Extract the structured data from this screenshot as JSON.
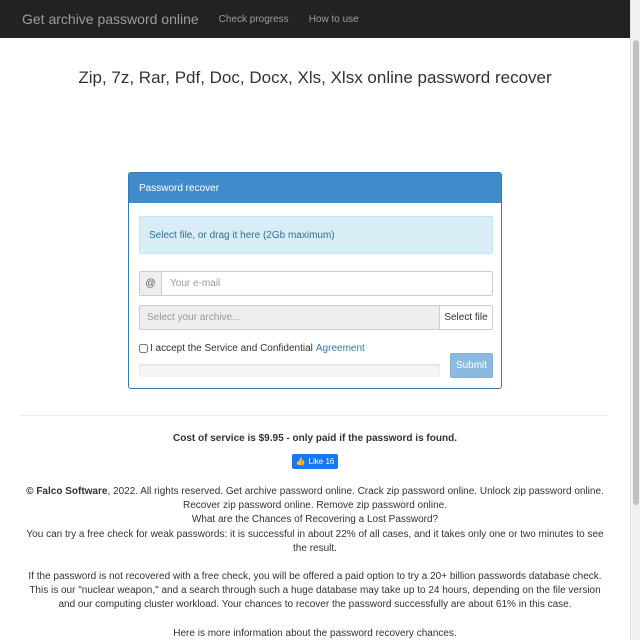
{
  "navbar": {
    "brand": "Get archive password online",
    "links": [
      "Check progress",
      "How to use"
    ]
  },
  "page_title": "Zip, 7z, Rar, Pdf, Doc, Docx, Xls, Xlsx online password recover",
  "panel": {
    "heading": "Password recover",
    "drop_zone_text": "Select file, or drag it here (2Gb maximum)",
    "email_addon": "@",
    "email_placeholder": "Your e-mail",
    "archive_placeholder": "Select your archive...",
    "select_file_label": "Select file",
    "agree_text": "I accept the Service and Confidential",
    "agree_link": "Agreement",
    "agree_checked": false,
    "submit_label": "Submit",
    "progress": 0
  },
  "cost_text": "Cost of service is $9.95 - only paid if the password is found.",
  "like": {
    "label": "Like",
    "count": "16",
    "color": "#1877f2"
  },
  "footer": {
    "company": "© Falco Software",
    "line1_rest": ", 2022. All rights reserved. Get archive password online. Crack zip password online. Unlock zip password online. Recover zip password online. Remove zip password online.",
    "question": "What are the Chances of Recovering a Lost Password?",
    "free_check": "You can try a free check for weak passwords: it is successful in about 22% of all cases, and it takes only one or two minutes to see the result.",
    "paid_option": "If the password is not recovered with a free check, you will be offered a paid option to try a 20+ billion passwords database check. This is our \"nuclear weapon,\" and a search through such a huge database may take up to 24 hours, depending on the file version and our computing cluster workload. Your chances to recover the password successfully are about 61% in this case.",
    "more_info": "Here is more information about the password recovery chances."
  },
  "colors": {
    "navbar_bg": "#222222",
    "panel_heading": "#428bca",
    "info_bg": "#d9edf7",
    "submit": "#8cb9de"
  }
}
